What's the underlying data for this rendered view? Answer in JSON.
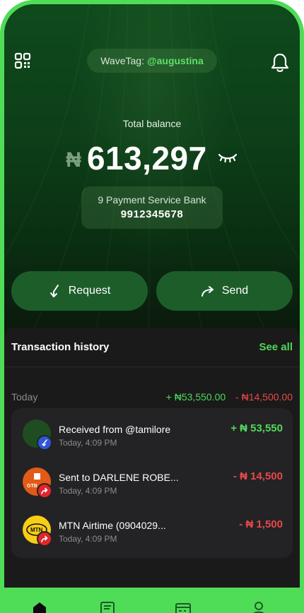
{
  "header": {
    "wavetag_label": "WaveTag:",
    "wavetag_value": "@augustina"
  },
  "balance": {
    "label": "Total balance",
    "currency": "₦",
    "amount": "613,297"
  },
  "bank": {
    "name": "9 Payment Service Bank",
    "account_number": "9912345678"
  },
  "actions": {
    "request_label": "Request",
    "send_label": "Send"
  },
  "history": {
    "title": "Transaction history",
    "see_all": "See all",
    "day_label": "Today",
    "day_in_total": "+ ₦53,550.00",
    "day_out_total": "- ₦14,500.00",
    "transactions": [
      {
        "title": "Received from @tamilore",
        "time": "Today, 4:09 PM",
        "amount": "+ ₦ 53,550",
        "direction": "in",
        "avatar_icon": "user-avatar-icon",
        "badge_icon": "incoming-arrow-icon"
      },
      {
        "title": "Sent to DARLENE ROBE...",
        "time": "Today, 4:09 PM",
        "amount": "- ₦ 14,500",
        "direction": "out",
        "avatar_icon": "gtbank-logo-icon",
        "avatar_text": "GTB",
        "badge_icon": "outgoing-arrow-icon"
      },
      {
        "title": "MTN Airtime (0904029...",
        "time": "Today, 4:09 PM",
        "amount": "- ₦ 1,500",
        "direction": "out",
        "avatar_icon": "mtn-logo-icon",
        "avatar_text": "MTN",
        "badge_icon": "outgoing-arrow-icon"
      }
    ]
  },
  "nav": {
    "items": [
      "home-icon",
      "transactions-icon",
      "cards-icon",
      "profile-icon"
    ]
  },
  "colors": {
    "accent": "#4fdc57",
    "hero_green": "#0f4a1c",
    "positive": "#4fd85a",
    "negative": "#e8484a",
    "sheet": "#1a1a1a",
    "card": "#232325"
  }
}
